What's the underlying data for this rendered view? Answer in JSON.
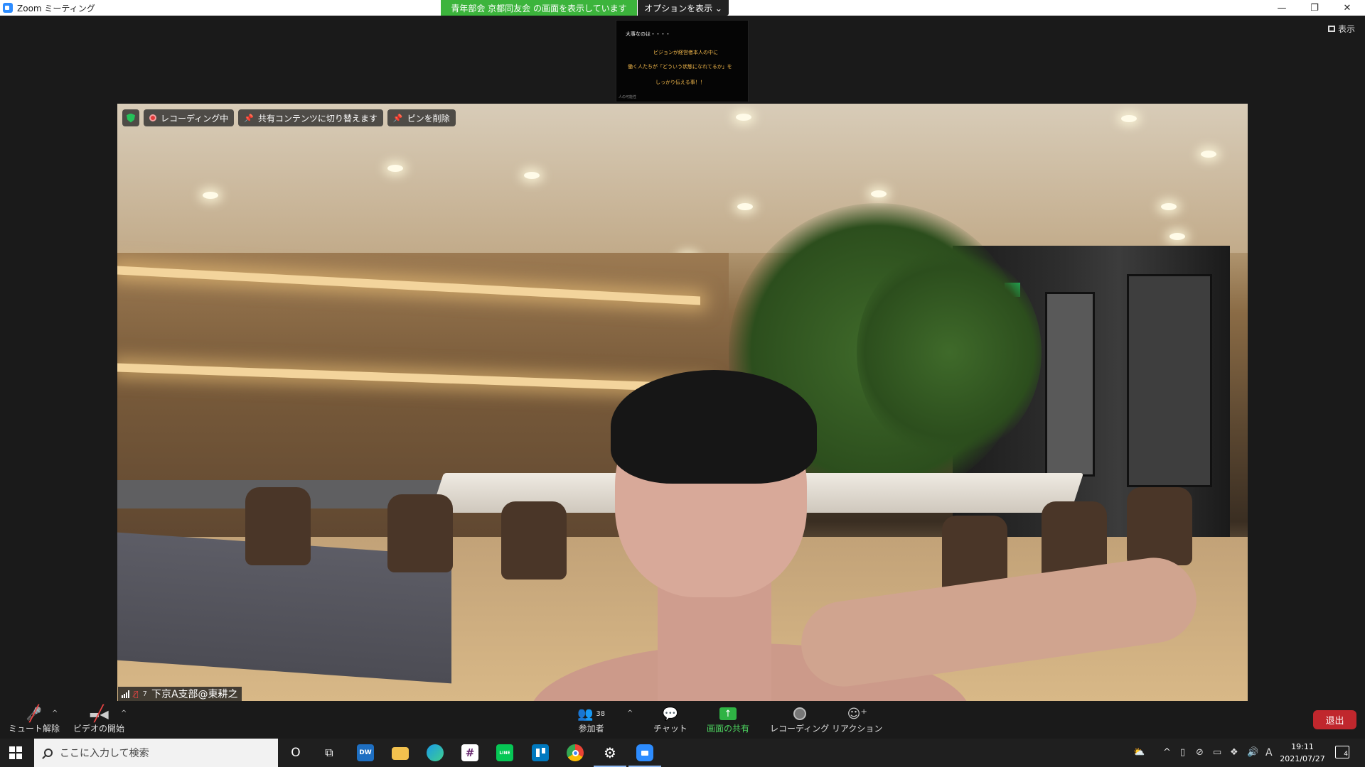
{
  "window": {
    "title": "Zoom ミーティング",
    "share_banner": "青年部会 京都同友会 の画面を表示しています",
    "options_label": "オプションを表示 ⌄"
  },
  "view": {
    "label": "表示"
  },
  "thumbnail": {
    "lines": [
      "大事なのは・・・・",
      "ビジョンが経営者本人の中に",
      "働く人たちが「どういう状態になれてるか」を",
      "しっかり伝える事！！"
    ],
    "footer": "人の可能性"
  },
  "video_overlay": {
    "recording": "レコーディング中",
    "switch_shared": "共有コンテンツに切り替えます",
    "unpin": "ピンを削除"
  },
  "speaker": {
    "number": "7",
    "name": "下京A支部@東耕之"
  },
  "toolbar": {
    "unmute": "ミュート解除",
    "start_video": "ビデオの開始",
    "participants": "参加者",
    "participants_count": "38",
    "chat": "チャット",
    "share_screen": "画面の共有",
    "recording": "レコーディング",
    "reaction": "リアクション",
    "leave": "退出"
  },
  "taskbar": {
    "search_placeholder": "ここに入力して検索",
    "time": "19:11",
    "date": "2021/07/27",
    "ime": "A",
    "notifications": "4",
    "apps": [
      {
        "name": "cortana",
        "label": "O"
      },
      {
        "name": "task-view",
        "label": "⧉"
      },
      {
        "name": "dw",
        "label": "DW"
      },
      {
        "name": "file-explorer",
        "label": ""
      },
      {
        "name": "edge",
        "label": ""
      },
      {
        "name": "slack",
        "label": "#"
      },
      {
        "name": "line",
        "label": "LINE"
      },
      {
        "name": "trello",
        "label": ""
      },
      {
        "name": "chrome",
        "label": ""
      },
      {
        "name": "settings",
        "label": "⚙"
      },
      {
        "name": "zoom",
        "label": ""
      }
    ]
  },
  "colors": {
    "share_green": "#3cb43c",
    "leave_red": "#c0272d",
    "zoom_blue": "#2d8cff"
  }
}
